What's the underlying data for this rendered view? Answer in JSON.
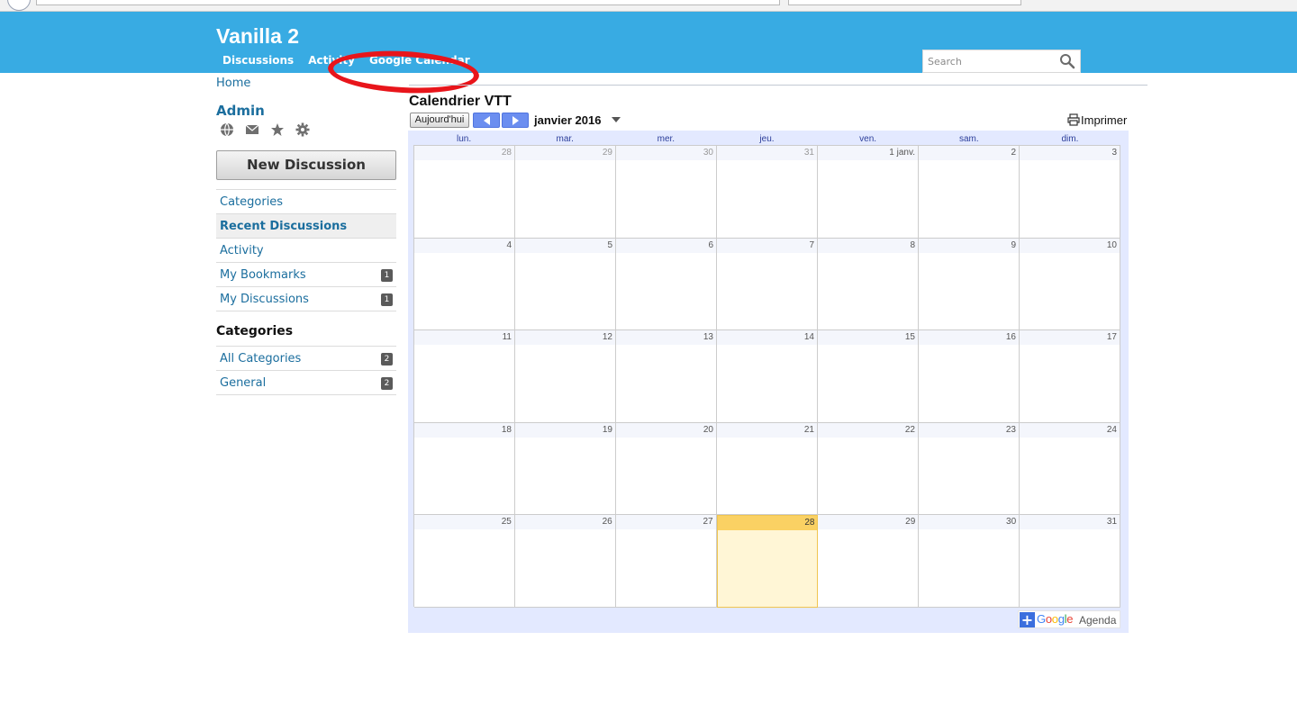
{
  "colors": {
    "header_bg": "#38abe3",
    "link": "#1b6e9e",
    "today_header": "#fad163",
    "today_bg": "#fff6d6",
    "highlight_oval": "#e8151b"
  },
  "site": {
    "title": "Vanilla 2"
  },
  "nav": {
    "items": [
      "Discussions",
      "Activity",
      "Google Calendar"
    ]
  },
  "search": {
    "placeholder": "Search"
  },
  "breadcrumb": {
    "home": "Home"
  },
  "user": {
    "name": "Admin",
    "icons": [
      "globe-icon",
      "mail-icon",
      "star-icon",
      "gear-icon"
    ]
  },
  "sidebar": {
    "new_discussion": "New Discussion",
    "menu": [
      {
        "label": "Categories",
        "count": ""
      },
      {
        "label": "Recent Discussions",
        "count": "",
        "active": true
      },
      {
        "label": "Activity",
        "count": ""
      },
      {
        "label": "My Bookmarks",
        "count": "1"
      },
      {
        "label": "My Discussions",
        "count": "1"
      }
    ],
    "categories_heading": "Categories",
    "categories": [
      {
        "label": "All Categories",
        "count": "2"
      },
      {
        "label": "General",
        "count": "2"
      }
    ]
  },
  "calendar": {
    "title": "Calendrier VTT",
    "today_button": "Aujourd'hui",
    "month": "janvier 2016",
    "print": "Imprimer",
    "weekdays": [
      "lun.",
      "mar.",
      "mer.",
      "jeu.",
      "ven.",
      "sam.",
      "dim."
    ],
    "weeks": [
      [
        "28",
        "29",
        "30",
        "31",
        "1 janv.",
        "2",
        "3"
      ],
      [
        "4",
        "5",
        "6",
        "7",
        "8",
        "9",
        "10"
      ],
      [
        "11",
        "12",
        "13",
        "14",
        "15",
        "16",
        "17"
      ],
      [
        "18",
        "19",
        "20",
        "21",
        "22",
        "23",
        "24"
      ],
      [
        "25",
        "26",
        "27",
        "28",
        "29",
        "30",
        "31"
      ]
    ],
    "other_month_days": 4,
    "today": "28",
    "badge": {
      "google": "Google",
      "agenda": "Agenda"
    }
  }
}
